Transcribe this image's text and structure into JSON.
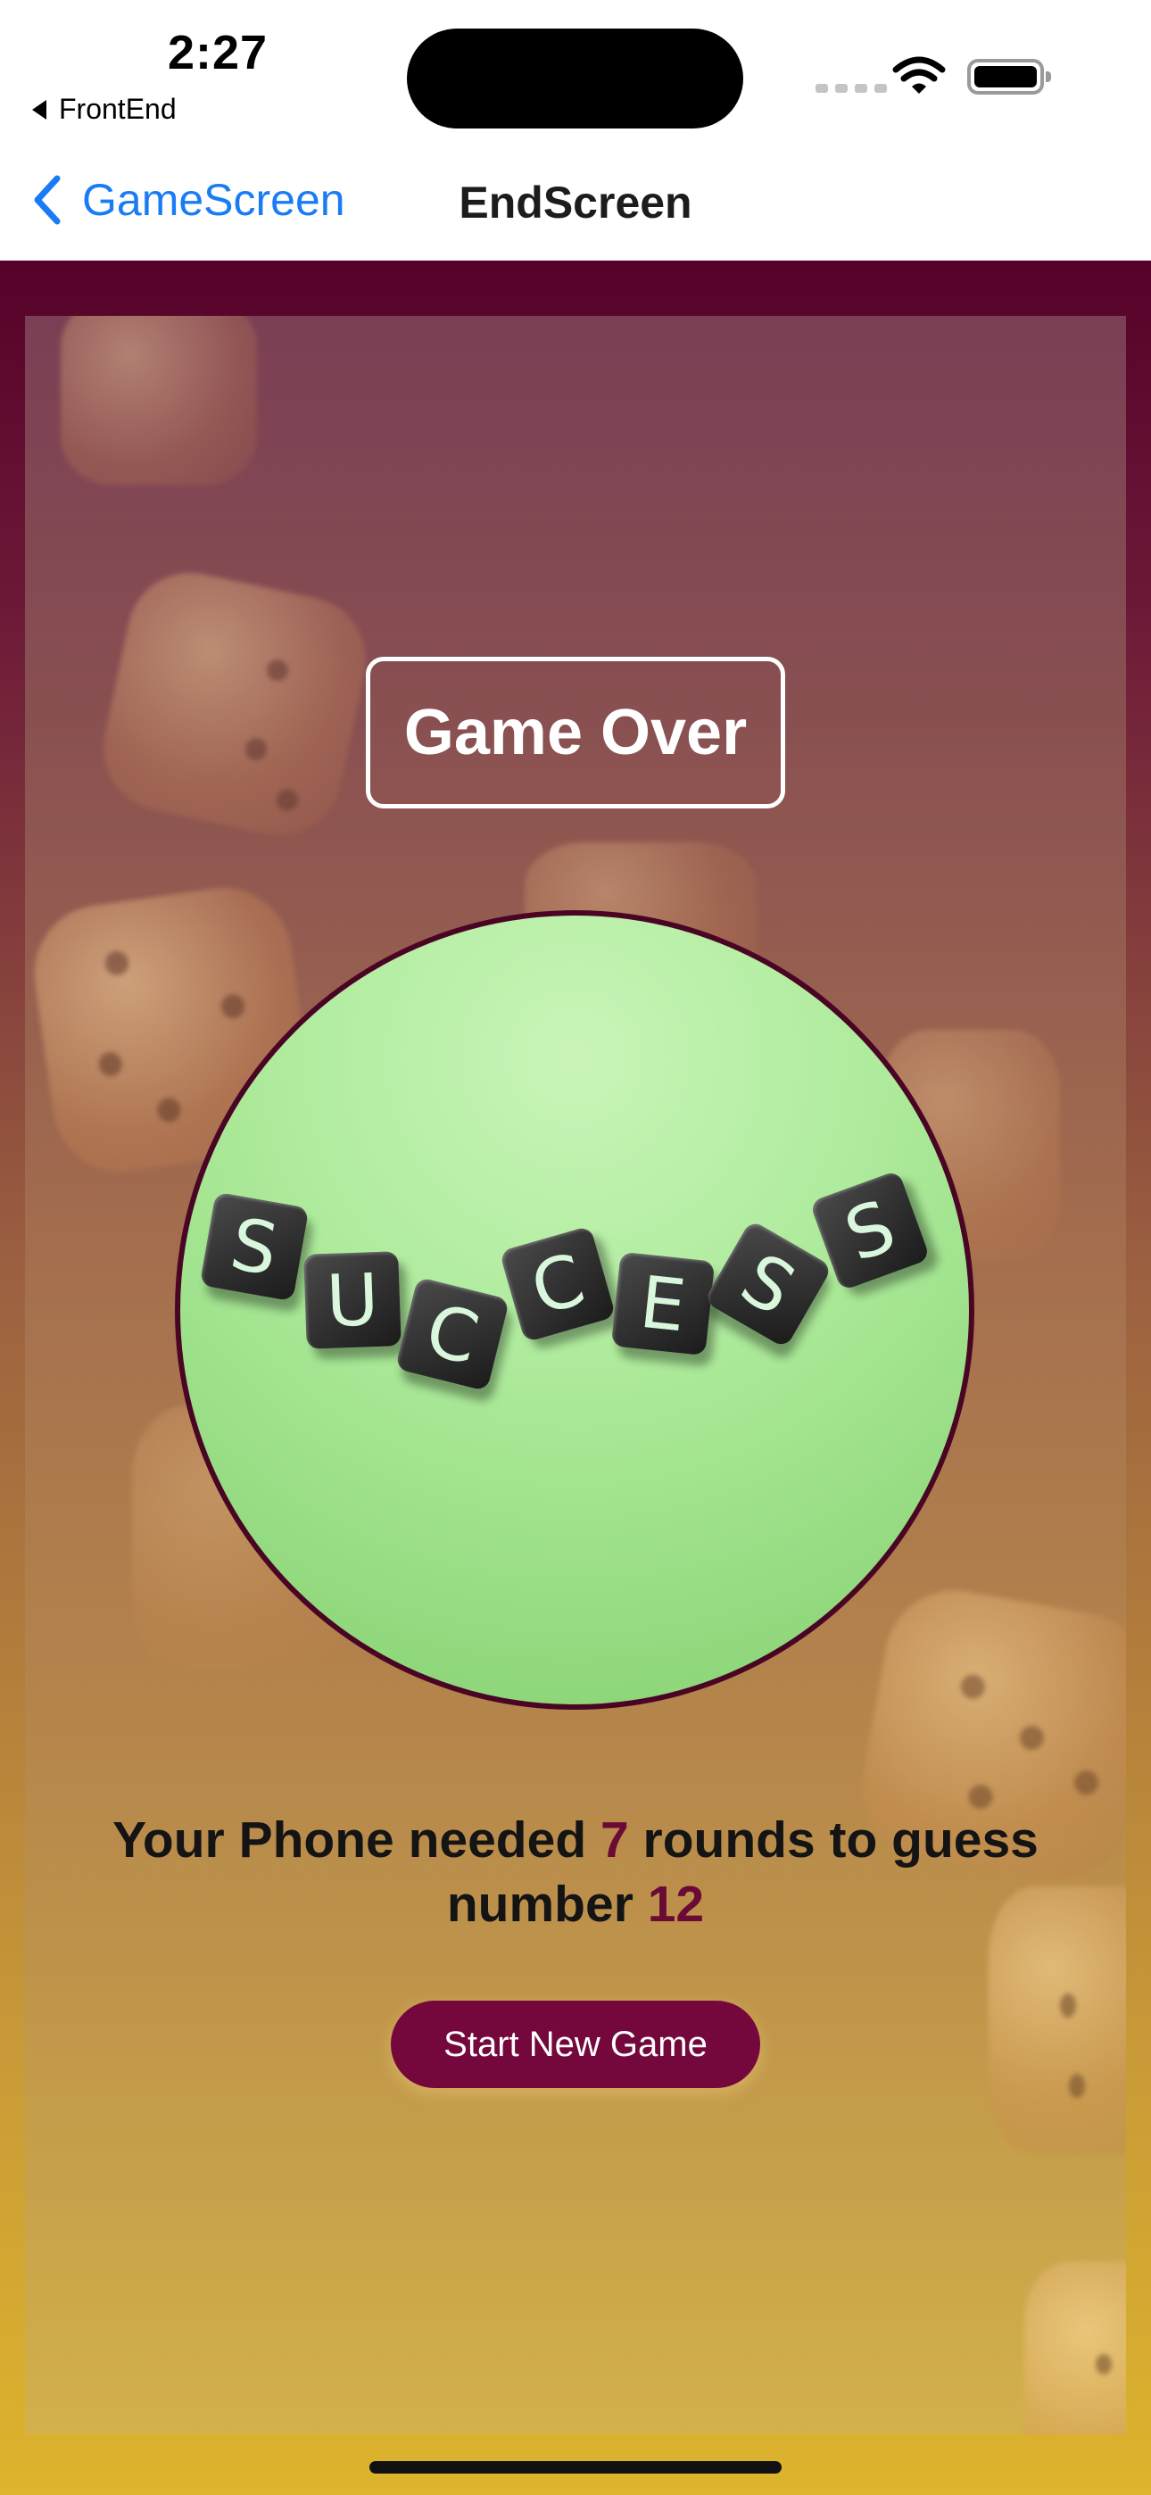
{
  "status_bar": {
    "time": "2:27",
    "back_app": "FrontEnd"
  },
  "nav": {
    "back_label": "GameScreen",
    "title": "EndScreen"
  },
  "content": {
    "title": "Game Over",
    "success_image": {
      "letters": [
        "S",
        "U",
        "C",
        "C",
        "E",
        "S",
        "S"
      ]
    },
    "result": {
      "part1": "Your Phone needed ",
      "rounds": "7",
      "part2": " rounds to guess number ",
      "number": "12"
    },
    "button_label": "Start New Game"
  },
  "colors": {
    "outer_top": "#560229",
    "outer_bottom": "#ddb42c",
    "accent": "#74083c",
    "highlight_text": "#6a0a35",
    "nav_link": "#1a7cf5",
    "circle_border": "#4a0525"
  },
  "icons": [
    "back-triangle-icon",
    "chevron-left-icon",
    "signal-icon",
    "wifi-icon",
    "battery-icon"
  ]
}
